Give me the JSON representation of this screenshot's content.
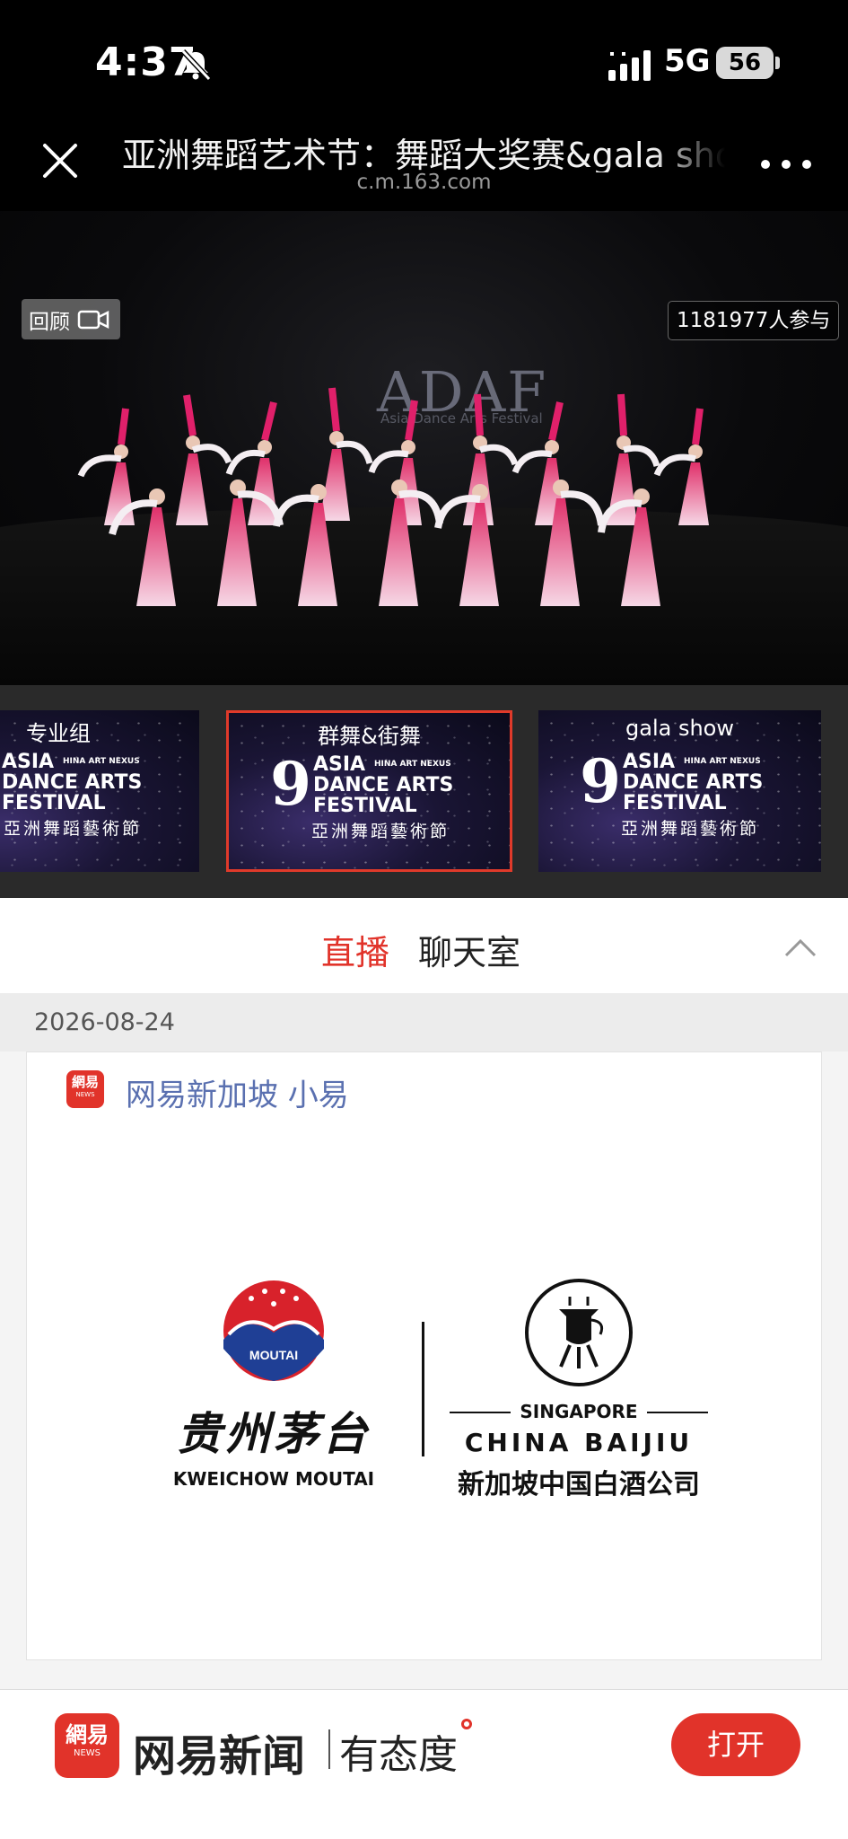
{
  "status_bar": {
    "time": "4:37",
    "network": "5G",
    "battery": "56"
  },
  "header": {
    "title": "亚洲舞蹈艺术节：舞蹈大奖赛&gala show",
    "url": "c.m.163.com"
  },
  "video": {
    "replay_label": "回顾",
    "participants": "1181977人参与",
    "logo_text": "ADAF",
    "logo_sub": "Asia Dance Arts Festival"
  },
  "thumbnails": [
    {
      "label": "专业组",
      "nexus": "HINA ART NEXUS",
      "festival": [
        "ASIA",
        "DANCE ARTS",
        "FESTIVAL"
      ],
      "cn": "亞洲舞蹈藝術節",
      "selected": false
    },
    {
      "label": "群舞&街舞",
      "nexus": "HINA ART NEXUS",
      "festival": [
        "ASIA",
        "DANCE ARTS",
        "FESTIVAL"
      ],
      "cn": "亞洲舞蹈藝術節",
      "selected": true
    },
    {
      "label": "gala show",
      "nexus": "HINA ART NEXUS",
      "festival": [
        "ASIA",
        "DANCE ARTS",
        "FESTIVAL"
      ],
      "cn": "亞洲舞蹈藝術節",
      "selected": false
    }
  ],
  "tabs": {
    "live": "直播",
    "chat": "聊天室"
  },
  "feed": {
    "date": "2026-08-24",
    "post": {
      "author": "网易新加坡 小易",
      "avatar_text": "網易",
      "avatar_sub": "NEWS",
      "logo_left": {
        "badge": "MOUTAI",
        "cn": "贵州茅台",
        "en": "KWEICHOW MOUTAI"
      },
      "logo_right": {
        "top": "SINGAPORE",
        "mid": "CHINA BAIJIU",
        "cn": "新加坡中国白酒公司"
      }
    }
  },
  "app_banner": {
    "logo_text": "網易",
    "logo_sub": "NEWS",
    "name": "网易新闻",
    "slogan": "有态度",
    "open_label": "打开"
  },
  "colors": {
    "accent": "#e1332a",
    "link": "#5a70b0",
    "background": "#000000"
  }
}
